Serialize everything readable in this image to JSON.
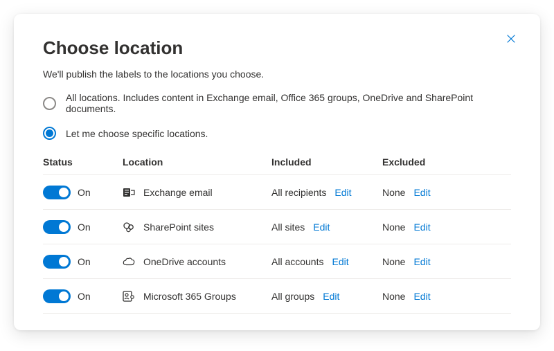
{
  "title": "Choose location",
  "subtitle": "We'll publish the labels to the locations you choose.",
  "close_aria": "Close",
  "radios": {
    "all": {
      "label": "All locations. Includes content in Exchange email, Office 365 groups, OneDrive and SharePoint documents.",
      "selected": false
    },
    "specific": {
      "label": "Let me choose specific locations.",
      "selected": true
    }
  },
  "headers": {
    "status": "Status",
    "location": "Location",
    "included": "Included",
    "excluded": "Excluded"
  },
  "status_on_label": "On",
  "edit_label": "Edit",
  "rows": [
    {
      "status": "On",
      "icon": "exchange-icon",
      "name": "Exchange email",
      "included": "All recipients",
      "excluded": "None"
    },
    {
      "status": "On",
      "icon": "sharepoint-icon",
      "name": "SharePoint sites",
      "included": "All sites",
      "excluded": "None"
    },
    {
      "status": "On",
      "icon": "onedrive-icon",
      "name": "OneDrive accounts",
      "included": "All accounts",
      "excluded": "None"
    },
    {
      "status": "On",
      "icon": "m365-groups-icon",
      "name": "Microsoft 365 Groups",
      "included": "All groups",
      "excluded": "None"
    }
  ],
  "colors": {
    "accent": "#0078D4",
    "border": "#EDEBE9",
    "text": "#323130"
  }
}
